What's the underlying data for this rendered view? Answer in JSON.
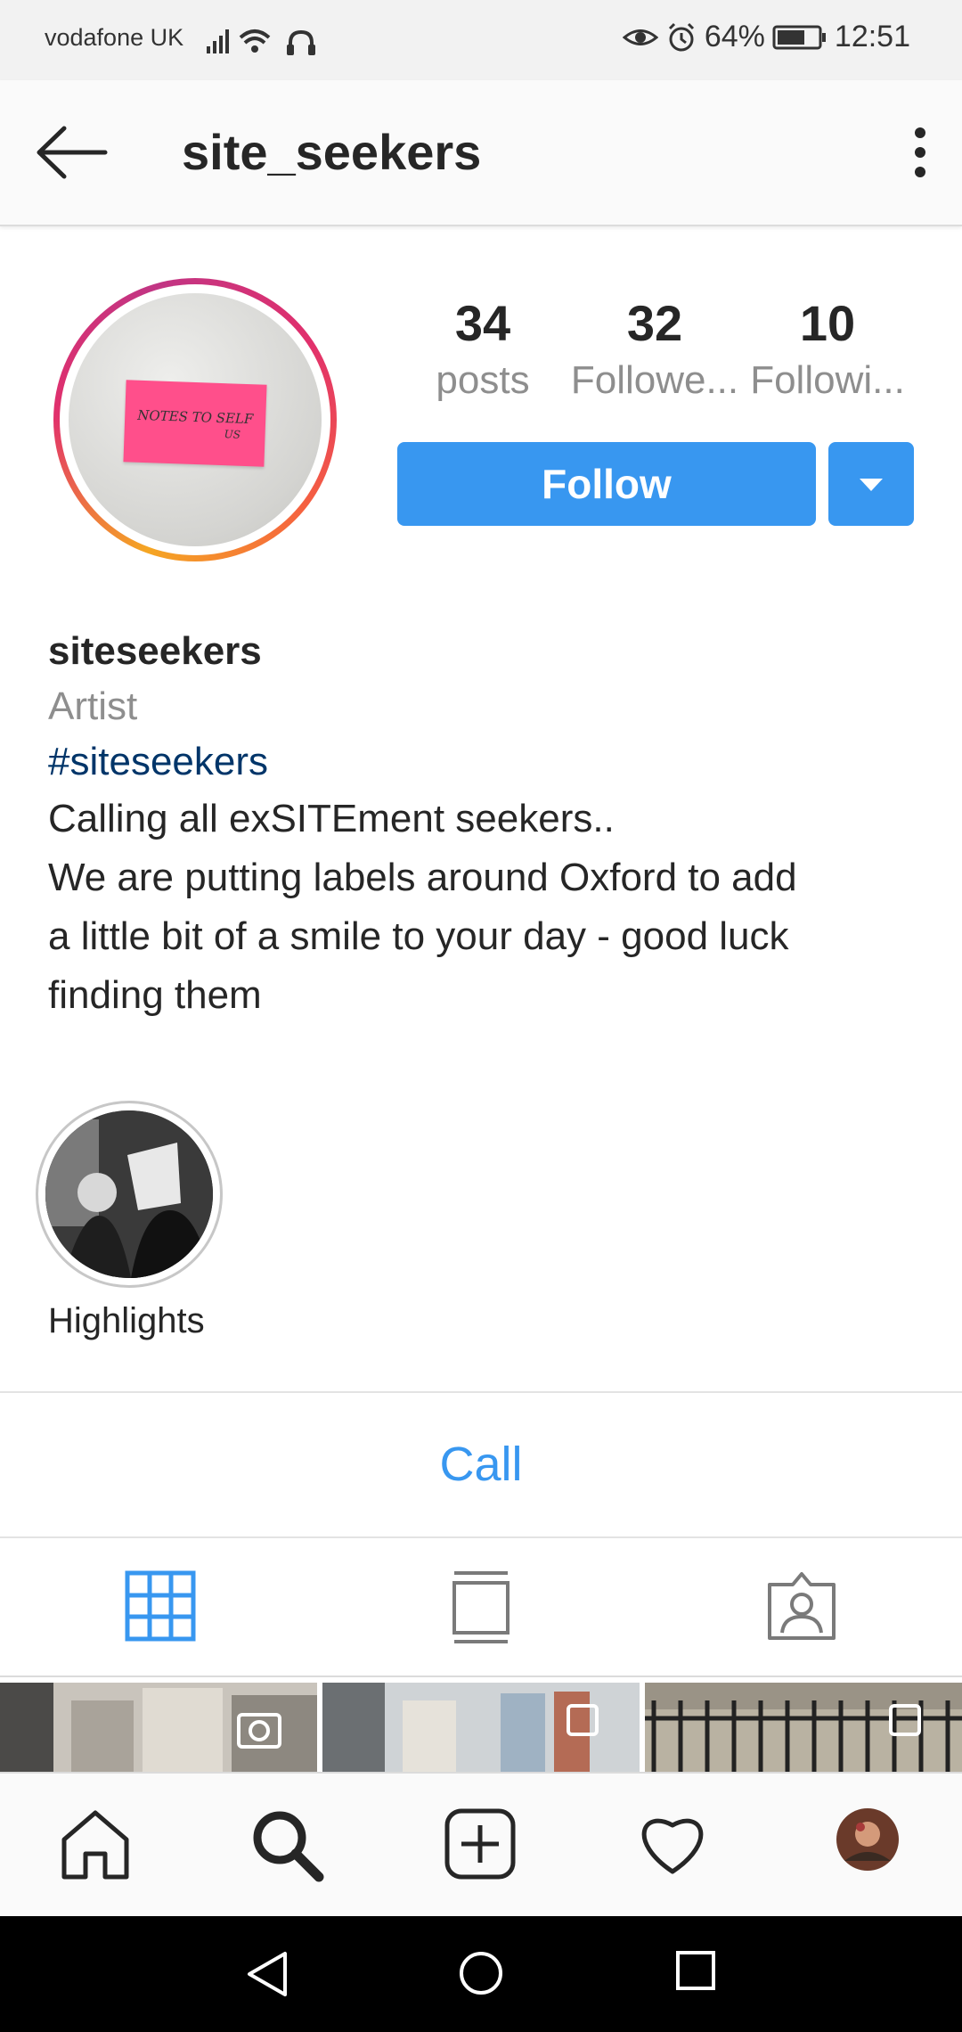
{
  "status": {
    "carrier": "vodafone UK",
    "battery": "64%",
    "time": "12:51"
  },
  "header": {
    "username": "site_seekers"
  },
  "stats": [
    {
      "num": "34",
      "label": "posts"
    },
    {
      "num": "32",
      "label": "Followe..."
    },
    {
      "num": "10",
      "label": "Followi..."
    }
  ],
  "follow_button": "Follow",
  "avatar_note": {
    "line1": "NOTES TO SELF",
    "line2": "US"
  },
  "bio": {
    "name": "siteseekers",
    "category": "Artist",
    "hashtag": "#siteseekers",
    "lines": [
      "Calling all exSITEment seekers..",
      "We are putting labels around Oxford to add",
      "a little bit of a smile to your day - good luck",
      "finding them"
    ]
  },
  "highlight": {
    "label": "Highlights"
  },
  "call_button": "Call",
  "colors": {
    "accent": "#3897f0",
    "hashtag": "#003569",
    "muted": "#8e8e8e"
  },
  "icons": {
    "tabs": [
      "grid-icon",
      "feed-icon",
      "tagged-icon"
    ],
    "nav": [
      "home-icon",
      "search-icon",
      "add-icon",
      "heart-icon",
      "profile-avatar"
    ]
  }
}
